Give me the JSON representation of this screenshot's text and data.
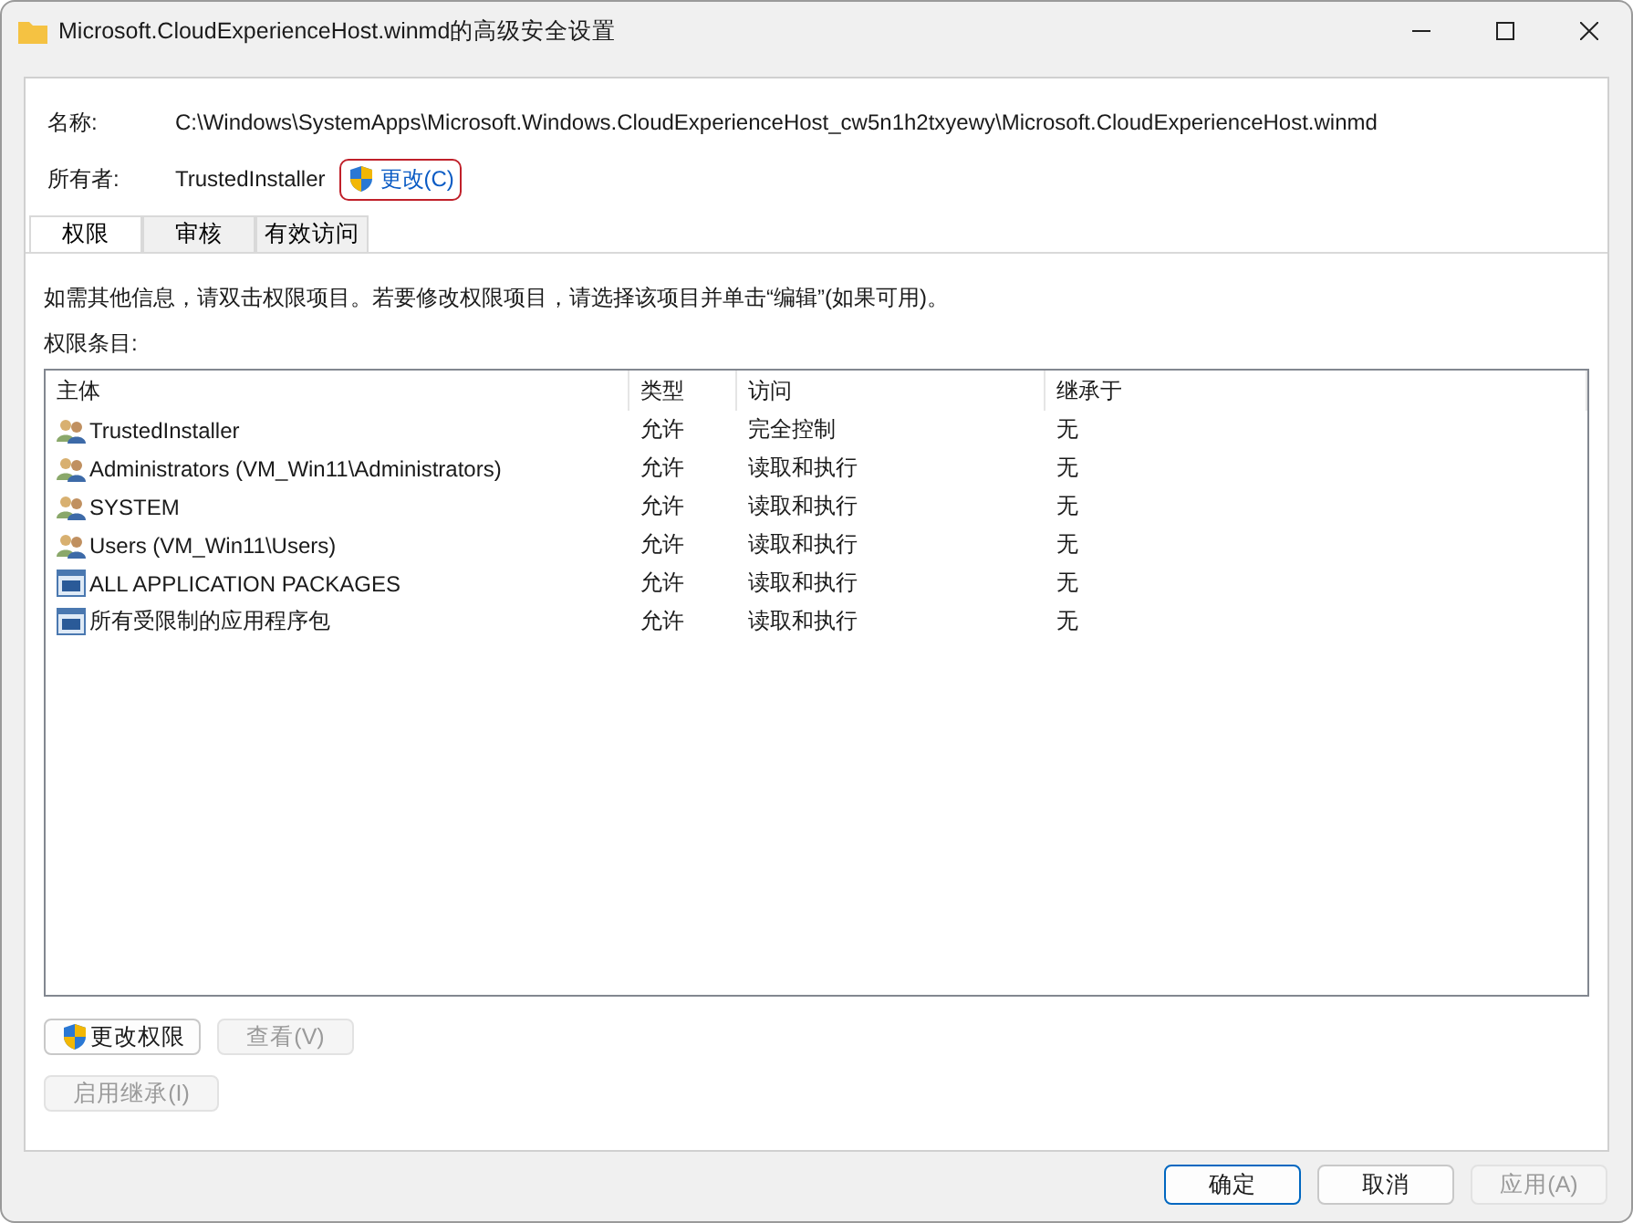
{
  "window": {
    "title": "Microsoft.CloudExperienceHost.winmd的高级安全设置"
  },
  "name": {
    "label": "名称:",
    "value": "C:\\Windows\\SystemApps\\Microsoft.Windows.CloudExperienceHost_cw5n1h2txyewy\\Microsoft.CloudExperienceHost.winmd"
  },
  "owner": {
    "label": "所有者:",
    "value": "TrustedInstaller",
    "change_link": "更改(C)"
  },
  "tabs": [
    {
      "label": "权限",
      "selected": true
    },
    {
      "label": "审核",
      "selected": false
    },
    {
      "label": "有效访问",
      "selected": false
    }
  ],
  "info_text": "如需其他信息，请双击权限项目。若要修改权限项目，请选择该项目并单击“编辑”(如果可用)。",
  "entries_label": "权限条目:",
  "table": {
    "columns": [
      "主体",
      "类型",
      "访问",
      "继承于"
    ],
    "rows": [
      {
        "kind": "group",
        "principal": "TrustedInstaller",
        "type": "允许",
        "access": "完全控制",
        "inherited_from": "无"
      },
      {
        "kind": "group",
        "principal": "Administrators (VM_Win11\\Administrators)",
        "type": "允许",
        "access": "读取和执行",
        "inherited_from": "无"
      },
      {
        "kind": "group",
        "principal": "SYSTEM",
        "type": "允许",
        "access": "读取和执行",
        "inherited_from": "无"
      },
      {
        "kind": "group",
        "principal": "Users (VM_Win11\\Users)",
        "type": "允许",
        "access": "读取和执行",
        "inherited_from": "无"
      },
      {
        "kind": "package",
        "principal": "ALL APPLICATION PACKAGES",
        "type": "允许",
        "access": "读取和执行",
        "inherited_from": "无"
      },
      {
        "kind": "package",
        "principal": "所有受限制的应用程序包",
        "type": "允许",
        "access": "读取和执行",
        "inherited_from": "无"
      }
    ]
  },
  "action_buttons": [
    {
      "label": "更改权限",
      "disabled": false,
      "shield": true
    },
    {
      "label": "查看(V)",
      "disabled": true,
      "shield": false
    }
  ],
  "inherit_button": {
    "label": "启用继承(I)",
    "disabled": true
  },
  "footer_buttons": [
    {
      "label": "确定",
      "disabled": false,
      "default": true
    },
    {
      "label": "取消",
      "disabled": false,
      "default": false
    },
    {
      "label": "应用(A)",
      "disabled": true,
      "default": false
    }
  ]
}
